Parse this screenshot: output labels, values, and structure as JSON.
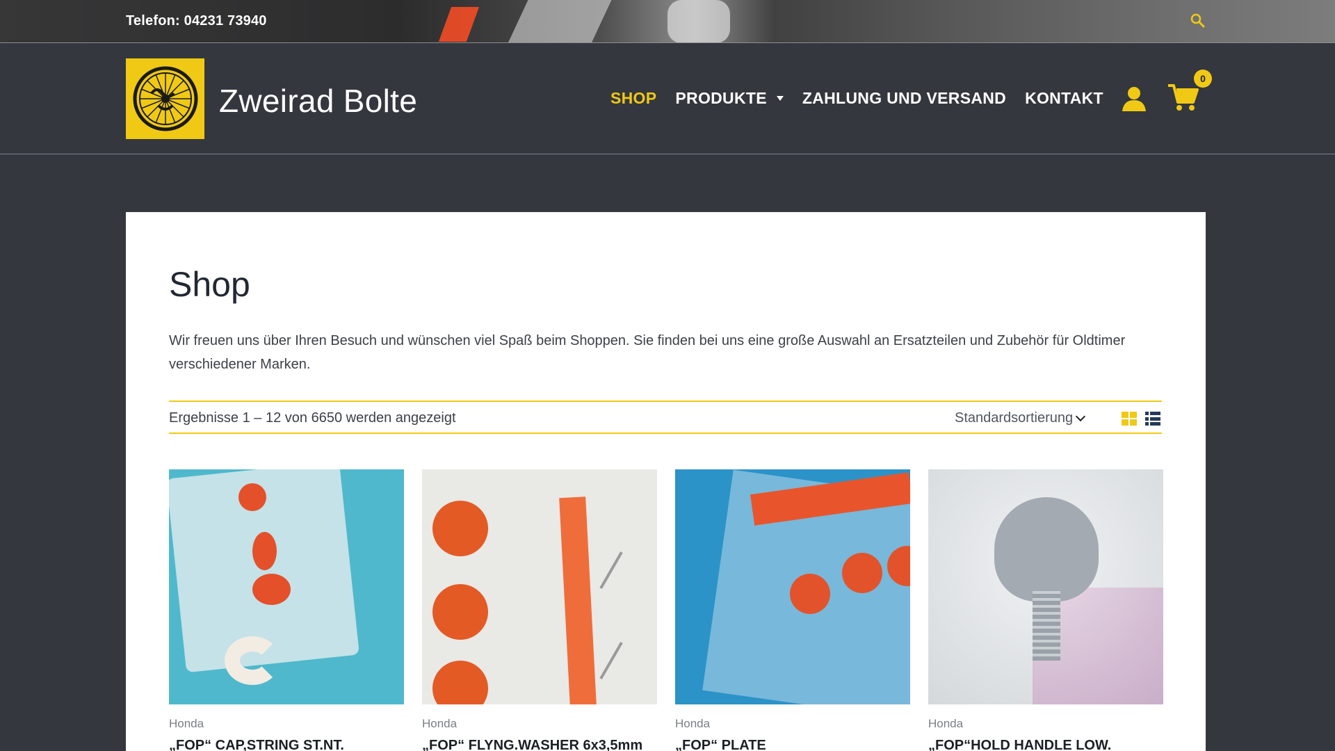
{
  "topbar": {
    "phone": "Telefon: 04231 73940",
    "search_icon": "search-icon"
  },
  "brand": {
    "name": "Zweirad Bolte"
  },
  "colors": {
    "accent": "#f0c915",
    "header_bg": "#34373e",
    "text_dark": "#222833"
  },
  "nav": {
    "items": [
      {
        "label": "SHOP",
        "active": true
      },
      {
        "label": "PRODUKTE",
        "has_dropdown": true
      },
      {
        "label": "ZAHLUNG UND VERSAND"
      },
      {
        "label": "KONTAKT"
      }
    ],
    "cart_count": "0",
    "user_icon": "user-icon",
    "cart_icon": "cart-icon"
  },
  "page": {
    "title": "Shop",
    "intro": "Wir freuen uns über Ihren Besuch und wünschen viel Spaß beim Shoppen. Sie finden bei uns eine große Auswahl an Ersatzteilen und Zubehör für Oldtimer verschiedener Marken."
  },
  "toolbar": {
    "results": "Ergebnisse 1 – 12 von 6650 werden angezeigt",
    "sort_selected": "Standardsortierung",
    "view_grid_icon": "grid-view-icon",
    "view_list_icon": "list-view-icon"
  },
  "products": [
    {
      "category": "Honda",
      "title": "„FOP“ CAP,STRING ST.NT."
    },
    {
      "category": "Honda",
      "title": "„FOP“ FLYNG.WASHER 6x3,5mm"
    },
    {
      "category": "Honda",
      "title": "„FOP“ PLATE"
    },
    {
      "category": "Honda",
      "title": "„FOP“HOLD HANDLE LOW."
    }
  ]
}
